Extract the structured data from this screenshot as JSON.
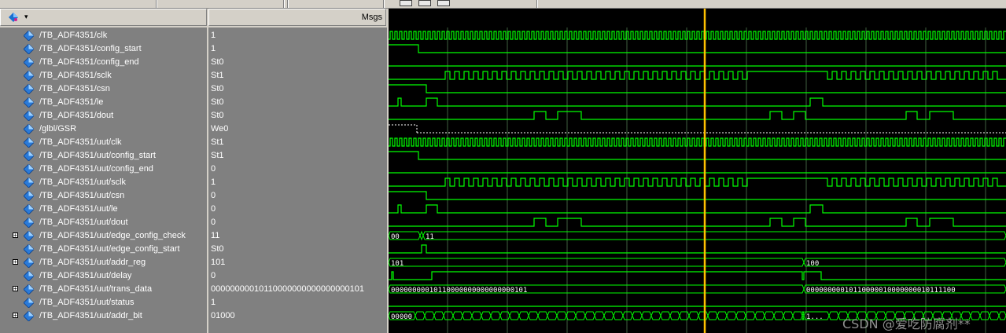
{
  "header": {
    "msgs_label": "Msgs"
  },
  "signals": [
    {
      "name": "/TB_ADF4351/clk",
      "value": "1",
      "type": "clock",
      "expandable": false
    },
    {
      "name": "/TB_ADF4351/config_start",
      "value": "1",
      "type": "bit",
      "expandable": false
    },
    {
      "name": "/TB_ADF4351/config_end",
      "value": "St0",
      "type": "bit",
      "expandable": false
    },
    {
      "name": "/TB_ADF4351/sclk",
      "value": "St1",
      "type": "sclk",
      "expandable": false
    },
    {
      "name": "/TB_ADF4351/csn",
      "value": "St0",
      "type": "bit",
      "expandable": false
    },
    {
      "name": "/TB_ADF4351/le",
      "value": "St0",
      "type": "bit",
      "expandable": false
    },
    {
      "name": "/TB_ADF4351/dout",
      "value": "St0",
      "type": "bit",
      "expandable": false
    },
    {
      "name": "/glbl/GSR",
      "value": "We0",
      "type": "bit",
      "expandable": false
    },
    {
      "name": "/TB_ADF4351/uut/clk",
      "value": "St1",
      "type": "clock",
      "expandable": false
    },
    {
      "name": "/TB_ADF4351/uut/config_start",
      "value": "St1",
      "type": "bit",
      "expandable": false
    },
    {
      "name": "/TB_ADF4351/uut/config_end",
      "value": "0",
      "type": "bit",
      "expandable": false
    },
    {
      "name": "/TB_ADF4351/uut/sclk",
      "value": "1",
      "type": "sclk",
      "expandable": false
    },
    {
      "name": "/TB_ADF4351/uut/csn",
      "value": "0",
      "type": "bit",
      "expandable": false
    },
    {
      "name": "/TB_ADF4351/uut/le",
      "value": "0",
      "type": "bit",
      "expandable": false
    },
    {
      "name": "/TB_ADF4351/uut/dout",
      "value": "0",
      "type": "bit",
      "expandable": false
    },
    {
      "name": "/TB_ADF4351/uut/edge_config_check",
      "value": "11",
      "type": "bus",
      "expandable": true
    },
    {
      "name": "/TB_ADF4351/uut/edge_config_start",
      "value": "St0",
      "type": "bit",
      "expandable": false
    },
    {
      "name": "/TB_ADF4351/uut/addr_reg",
      "value": "101",
      "type": "bus",
      "expandable": true
    },
    {
      "name": "/TB_ADF4351/uut/delay",
      "value": "0",
      "type": "bit",
      "expandable": false
    },
    {
      "name": "/TB_ADF4351/uut/trans_data",
      "value": "00000000010110000000000000000101",
      "type": "bus",
      "expandable": true
    },
    {
      "name": "/TB_ADF4351/uut/status",
      "value": "1",
      "type": "bit",
      "expandable": false
    },
    {
      "name": "/TB_ADF4351/uut/addr_bit",
      "value": "01000",
      "type": "bus",
      "expandable": true
    }
  ],
  "bus_labels": {
    "edge_config_check": [
      "00",
      "11"
    ],
    "addr_reg": [
      "101",
      "100"
    ],
    "trans_data": [
      "00000000010110000000000000000101",
      "00000000010110000010000000010111100"
    ],
    "addr_bit": [
      "00000",
      "1..."
    ]
  },
  "watermark": "CSDN @爱吃防腐剂**",
  "colors": {
    "wave": "#00ff00",
    "cursor": "#ffc000",
    "grid": "#406040",
    "background": "#000000"
  }
}
